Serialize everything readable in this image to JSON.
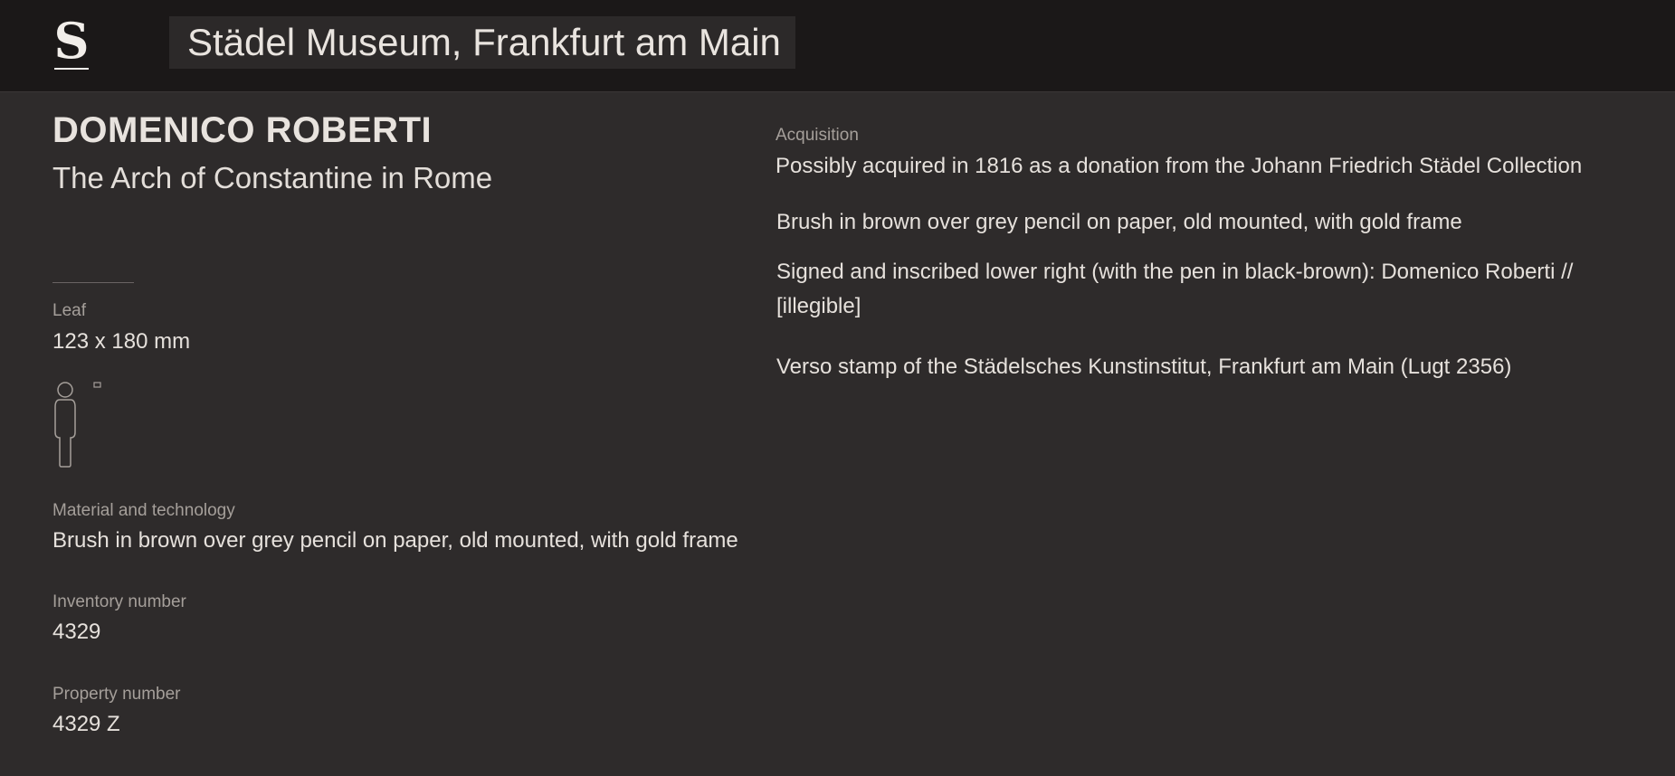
{
  "header": {
    "logo_letter": "S",
    "site_title": "Städel Museum, Frankfurt am Main"
  },
  "artwork": {
    "artist": "DOMENICO ROBERTI",
    "title": "The Arch of Constantine in Rome"
  },
  "details": {
    "leaf_label": "Leaf",
    "leaf_value": "123 x 180 mm",
    "material_label": "Material and technology",
    "material_value": "Brush in brown over grey pencil on paper, old mounted, with gold frame",
    "inventory_label": "Inventory number",
    "inventory_value": "4329",
    "property_label": "Property number",
    "property_value": "4329 Z"
  },
  "right_column": {
    "acquisition_label": "Acquisition",
    "acquisition_value": "Possibly acquired in 1816 as a donation from the Johann Friedrich Städel Collection",
    "technique_note": "Brush in brown over grey pencil on paper, old mounted, with gold frame",
    "inscription_note": "Signed and inscribed lower right (with the pen in black-brown): Domenico Roberti // [illegible]",
    "stamp_note": "Verso stamp of the Städelsches Kunstinstitut, Frankfurt am Main (Lugt 2356)"
  },
  "icons": {
    "logo": "stadel-logo-icon",
    "scale": "human-scale-icon",
    "artwork_size": "artwork-size-icon"
  }
}
